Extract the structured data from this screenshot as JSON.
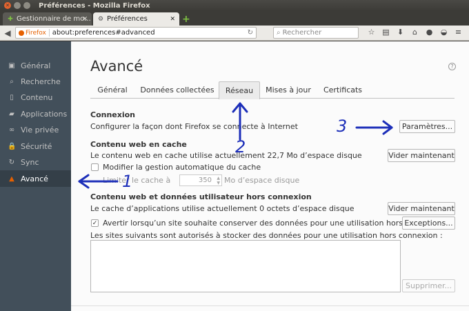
{
  "window": {
    "title": "Préférences - Mozilla Firefox"
  },
  "tabs": [
    {
      "label": "Gestionnaire de mo...",
      "icon": "puzzle-icon"
    },
    {
      "label": "Préférences",
      "icon": "gear-icon"
    }
  ],
  "navbar": {
    "identity": "Firefox",
    "url": "about:preferences#advanced",
    "search_placeholder": "Rechercher"
  },
  "sidebar": {
    "items": [
      {
        "label": "Général",
        "icon": "switch-icon"
      },
      {
        "label": "Recherche",
        "icon": "search-icon"
      },
      {
        "label": "Contenu",
        "icon": "document-icon"
      },
      {
        "label": "Applications",
        "icon": "applications-icon"
      },
      {
        "label": "Vie privée",
        "icon": "mask-icon"
      },
      {
        "label": "Sécurité",
        "icon": "lock-icon"
      },
      {
        "label": "Sync",
        "icon": "sync-icon"
      },
      {
        "label": "Avancé",
        "icon": "wizard-hat-icon",
        "selected": true
      }
    ]
  },
  "main": {
    "title": "Avancé",
    "tabs": [
      "Général",
      "Données collectées",
      "Réseau",
      "Mises à jour",
      "Certificats"
    ],
    "selected_tab": "Réseau",
    "connection": {
      "heading": "Connexion",
      "text": "Configurer la façon dont Firefox se connecte à Internet",
      "button": "Paramètres..."
    },
    "cache": {
      "heading": "Contenu web en cache",
      "text": "Le contenu web en cache utilise actuellement 22,7 Mo d’espace disque",
      "button": "Vider maintenant",
      "override_label": "Modifier la gestion automatique du cache",
      "limit_label": "Limiter le cache à",
      "limit_value": "350",
      "limit_unit": "Mo d’espace disque"
    },
    "offline": {
      "heading": "Contenu web et données utilisateur hors connexion",
      "text": "Le cache d’applications utilise actuellement 0 octets d’espace disque",
      "button": "Vider maintenant",
      "warn_label": "Avertir lorsqu’un site souhaite conserver des données pour une utilisation hors connexion",
      "warn_checked": true,
      "exceptions_button": "Exceptions...",
      "list_label": "Les sites suivants sont autorisés à stocker des données pour une utilisation hors connexion :",
      "remove_button": "Supprimer..."
    }
  },
  "annotations": {
    "one": "1",
    "two": "2",
    "three": "3",
    "color": "#1d2fb9"
  },
  "colors": {
    "sidebar_bg": "#424f5a",
    "sidebar_selected": "#343f48",
    "accent": "#e66000"
  }
}
